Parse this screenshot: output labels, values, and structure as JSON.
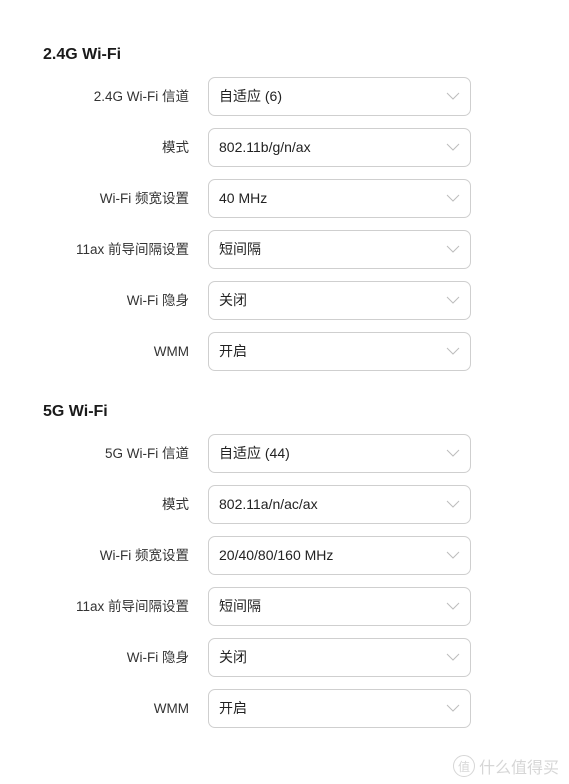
{
  "sections": [
    {
      "title": "2.4G Wi-Fi",
      "rows": [
        {
          "label": "2.4G Wi-Fi 信道",
          "value": "自适应 (6)"
        },
        {
          "label": "模式",
          "value": "802.11b/g/n/ax"
        },
        {
          "label": "Wi-Fi 频宽设置",
          "value": "40 MHz"
        },
        {
          "label": "11ax 前导间隔设置",
          "value": "短间隔"
        },
        {
          "label": "Wi-Fi 隐身",
          "value": "关闭"
        },
        {
          "label": "WMM",
          "value": "开启"
        }
      ]
    },
    {
      "title": "5G Wi-Fi",
      "rows": [
        {
          "label": "5G Wi-Fi 信道",
          "value": "自适应 (44)"
        },
        {
          "label": "模式",
          "value": "802.11a/n/ac/ax"
        },
        {
          "label": "Wi-Fi 频宽设置",
          "value": "20/40/80/160 MHz"
        },
        {
          "label": "11ax 前导间隔设置",
          "value": "短间隔"
        },
        {
          "label": "Wi-Fi 隐身",
          "value": "关闭"
        },
        {
          "label": "WMM",
          "value": "开启"
        }
      ]
    }
  ],
  "icons": {
    "dropdown": "chevron-down-icon"
  },
  "watermark": {
    "logo": "值",
    "text": "什么值得买"
  }
}
